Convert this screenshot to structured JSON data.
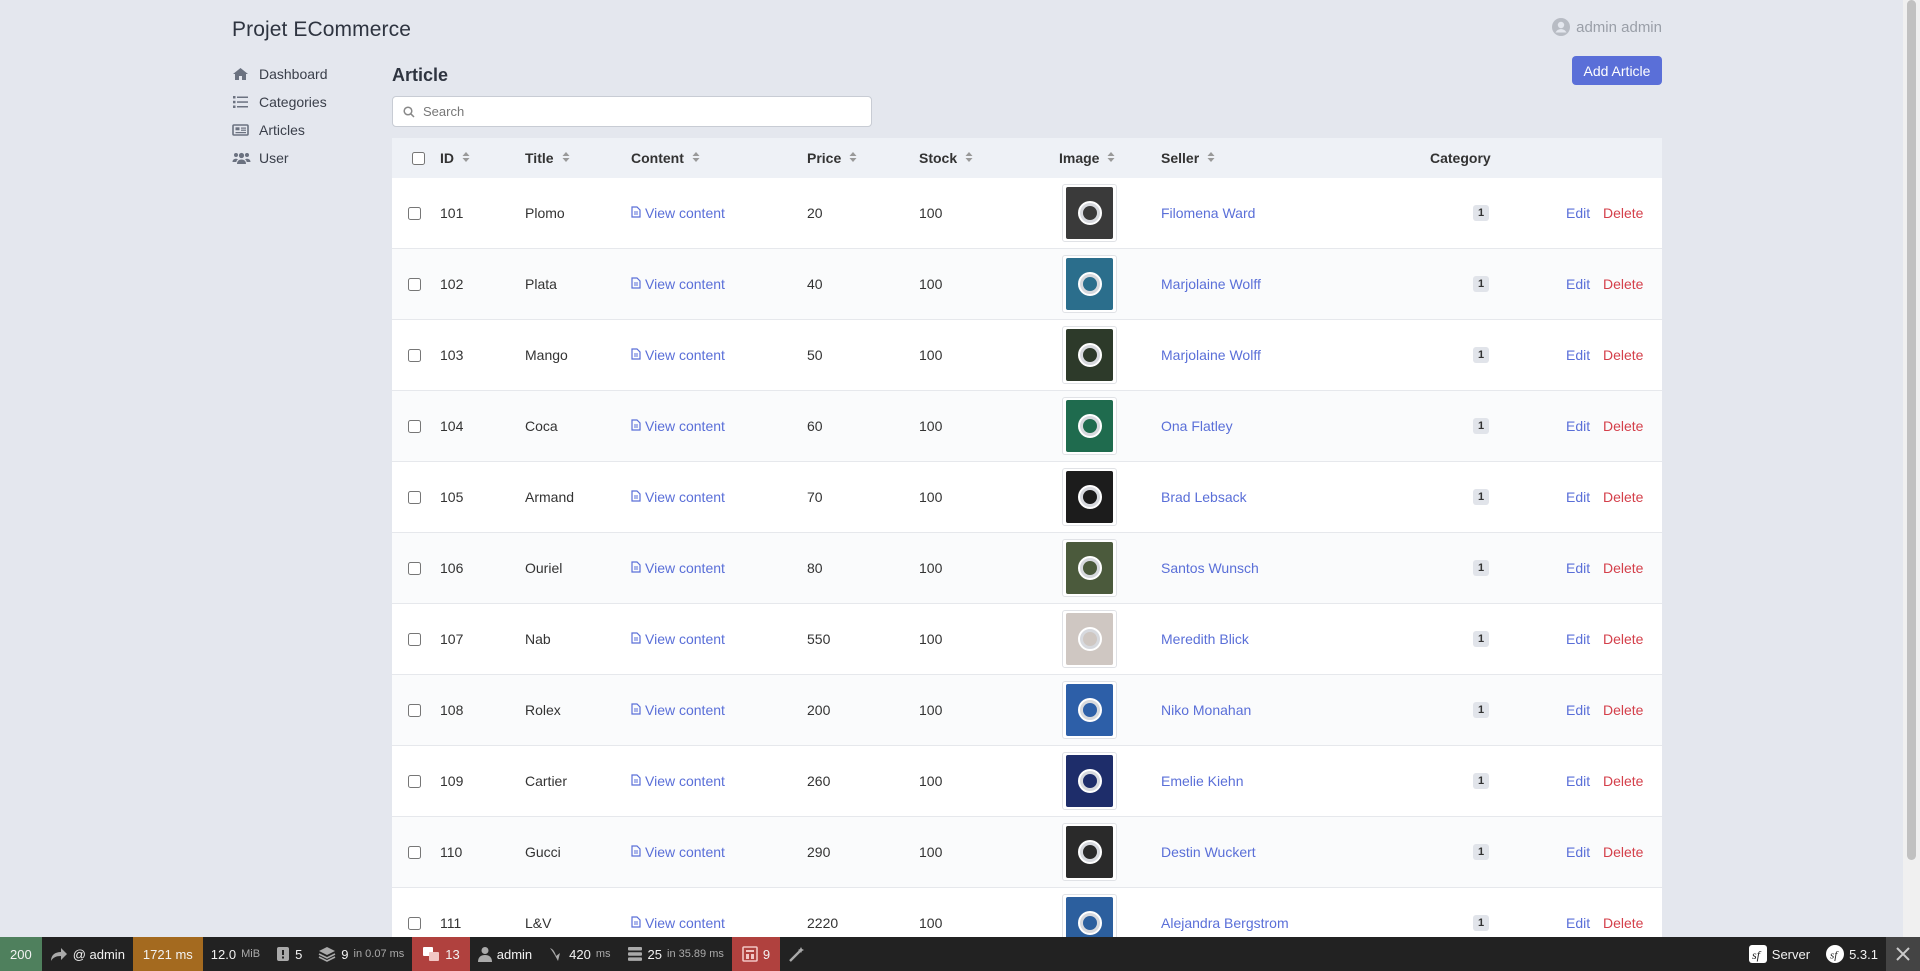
{
  "app": {
    "name": "Projet ECommerce"
  },
  "user_menu": {
    "label": "admin admin"
  },
  "sidebar": {
    "items": [
      {
        "label": "Dashboard",
        "icon": "home-icon"
      },
      {
        "label": "Categories",
        "icon": "list-icon"
      },
      {
        "label": "Articles",
        "icon": "newspaper-icon"
      },
      {
        "label": "User",
        "icon": "users-icon"
      }
    ]
  },
  "page": {
    "title": "Article",
    "add_button": "Add Article"
  },
  "search": {
    "placeholder": "Search"
  },
  "table": {
    "headers": {
      "id": "ID",
      "title": "Title",
      "content": "Content",
      "price": "Price",
      "stock": "Stock",
      "image": "Image",
      "seller": "Seller",
      "category": "Category"
    },
    "action_labels": {
      "edit": "Edit",
      "delete": "Delete",
      "view_content": "View content"
    },
    "rows": [
      {
        "id": "101",
        "title": "Plomo",
        "price": "20",
        "stock": "100",
        "seller": "Filomena Ward",
        "category": "1",
        "image_color": "#3a3a3a"
      },
      {
        "id": "102",
        "title": "Plata",
        "price": "40",
        "stock": "100",
        "seller": "Marjolaine Wolff",
        "category": "1",
        "image_color": "#2b6e8c"
      },
      {
        "id": "103",
        "title": "Mango",
        "price": "50",
        "stock": "100",
        "seller": "Marjolaine Wolff",
        "category": "1",
        "image_color": "#2d3a2a"
      },
      {
        "id": "104",
        "title": "Coca",
        "price": "60",
        "stock": "100",
        "seller": "Ona Flatley",
        "category": "1",
        "image_color": "#1f6b4e"
      },
      {
        "id": "105",
        "title": "Armand",
        "price": "70",
        "stock": "100",
        "seller": "Brad Lebsack",
        "category": "1",
        "image_color": "#1c1c1c"
      },
      {
        "id": "106",
        "title": "Ouriel",
        "price": "80",
        "stock": "100",
        "seller": "Santos Wunsch",
        "category": "1",
        "image_color": "#4b5a3c"
      },
      {
        "id": "107",
        "title": "Nab",
        "price": "550",
        "stock": "100",
        "seller": "Meredith Blick",
        "category": "1",
        "image_color": "#cfc7c2"
      },
      {
        "id": "108",
        "title": "Rolex",
        "price": "200",
        "stock": "100",
        "seller": "Niko Monahan",
        "category": "1",
        "image_color": "#2d5fa8"
      },
      {
        "id": "109",
        "title": "Cartier",
        "price": "260",
        "stock": "100",
        "seller": "Emelie Kiehn",
        "category": "1",
        "image_color": "#1e2d6a"
      },
      {
        "id": "110",
        "title": "Gucci",
        "price": "290",
        "stock": "100",
        "seller": "Destin Wuckert",
        "category": "1",
        "image_color": "#2a2a2a"
      },
      {
        "id": "111",
        "title": "L&V",
        "price": "2220",
        "stock": "100",
        "seller": "Alejandra Bergstrom",
        "category": "1",
        "image_color": "#2c5f9e"
      }
    ]
  },
  "toolbar": {
    "status": "200",
    "route": "@ admin",
    "time": "1721 ms",
    "memory": "12.0",
    "memory_unit": "MiB",
    "logs": "5",
    "cache": "9",
    "cache_detail": "in 0.07 ms",
    "translations": "13",
    "user": "admin",
    "events": "420",
    "events_unit": "ms",
    "db_queries": "25",
    "db_detail": "in 35.89 ms",
    "forms": "9",
    "server": "Server",
    "version": "5.3.1",
    "colors": {
      "status": "#4f805d",
      "time": "#a46a1f",
      "errors": "#b0413e"
    }
  }
}
